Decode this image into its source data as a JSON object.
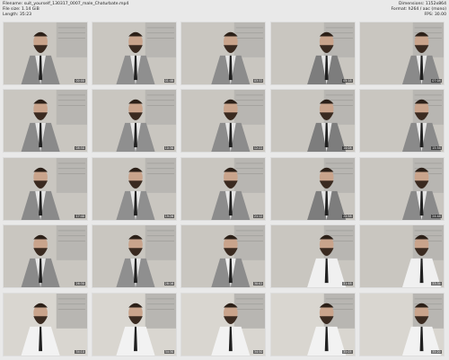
{
  "meta": {
    "filename_line": "Filename: suit_yourself_130317_0007_male_Chaturbate.mp4",
    "filesize_line": "File size: 1.14 GiB",
    "length_line": "Length: 35:23",
    "dimensions_line": "Dimensions: 1152x864",
    "format_line": "Format: h264 / aac (mono)",
    "fps_line": "FPS: 30.00"
  },
  "frames": [
    {
      "time": "00:00"
    },
    {
      "time": "01:46"
    },
    {
      "time": "03:32"
    },
    {
      "time": "05:18"
    },
    {
      "time": "07:04"
    },
    {
      "time": "08:50"
    },
    {
      "time": "10:36"
    },
    {
      "time": "12:22"
    },
    {
      "time": "14:08"
    },
    {
      "time": "15:54"
    },
    {
      "time": "17:40"
    },
    {
      "time": "19:26"
    },
    {
      "time": "21:12"
    },
    {
      "time": "22:58"
    },
    {
      "time": "24:44"
    },
    {
      "time": "26:30"
    },
    {
      "time": "28:16"
    },
    {
      "time": "30:02"
    },
    {
      "time": "31:48"
    },
    {
      "time": "33:34"
    },
    {
      "time": "34:10"
    },
    {
      "time": "34:30"
    },
    {
      "time": "34:50"
    },
    {
      "time": "35:05"
    },
    {
      "time": "35:20"
    }
  ]
}
